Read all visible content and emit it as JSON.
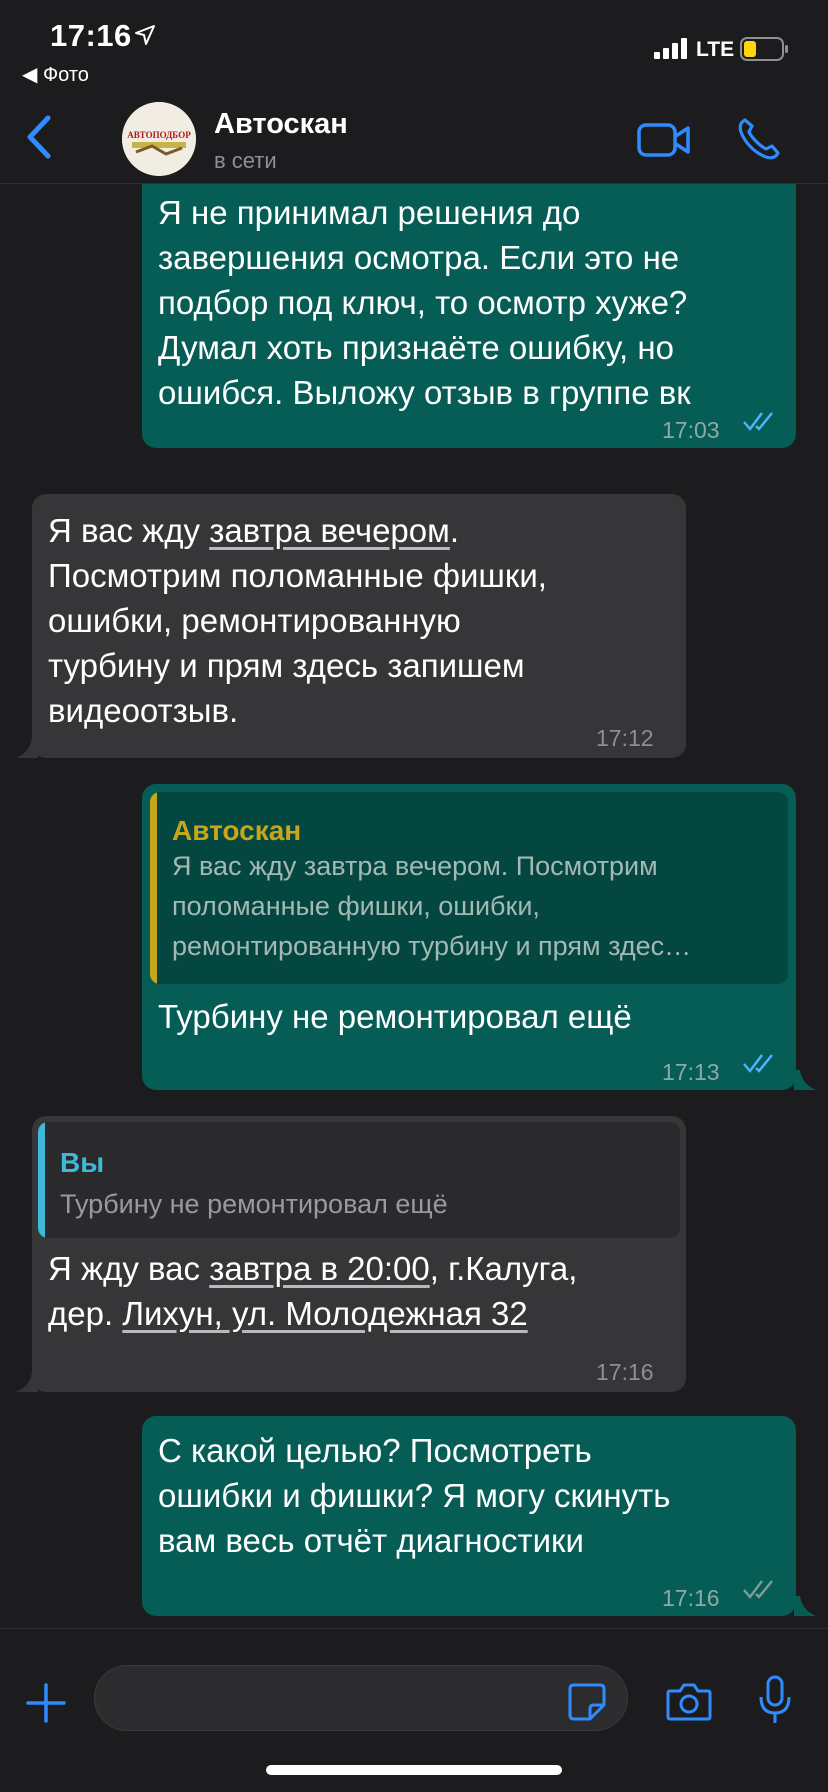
{
  "status_bar": {
    "time": "17:16",
    "back_app": "◀ Фото",
    "network": "LTE"
  },
  "header": {
    "contact_name": "Автоскан",
    "contact_status": "в сети",
    "avatar_text": "АВТОПОДБОР"
  },
  "messages": [
    {
      "direction": "outgoing",
      "lines": [
        "Я не принимал решения до",
        "завершения осмотра. Если это не",
        "подбор под ключ, то осмотр хуже?",
        "Думал хоть признаёте ошибку, но",
        "ошибся. Выложу отзыв в группе вк"
      ],
      "time": "17:03",
      "status": "read"
    },
    {
      "direction": "incoming",
      "line1_before": "Я вас жду ",
      "line1_link": "завтра вечером",
      "line1_after": ".",
      "lines_rest": [
        "Посмотрим поломанные фишки,",
        "ошибки, ремонтированную",
        "турбину и прям здесь запишем",
        "видеоотзыв."
      ],
      "time": "17:12"
    },
    {
      "direction": "outgoing",
      "quote_name": "Автоскан",
      "quote_lines": [
        "Я вас жду завтра вечером. Посмотрим",
        "поломанные фишки, ошибки,",
        "ремонтированную турбину и прям здес…"
      ],
      "text": "Турбину не ремонтировал ещё",
      "time": "17:13",
      "status": "read"
    },
    {
      "direction": "incoming",
      "quote_name": "Вы",
      "quote_text": "Турбину не ремонтировал ещё",
      "line1_before": "Я жду вас ",
      "line1_link": "завтра в 20:00",
      "line1_after": ", г.Калуга,",
      "line2_before": "дер. ",
      "line2_link": "Лихун, ул. Молодежная 32",
      "time": "17:16"
    },
    {
      "direction": "outgoing",
      "lines": [
        "С какой целью? Посмотреть",
        "ошибки и фишки? Я могу скинуть",
        "вам весь отчёт диагностики"
      ],
      "time": "17:16",
      "status": "delivered"
    }
  ],
  "colors": {
    "outgoing_bubble": "#055d56",
    "incoming_bubble": "#363638",
    "accent_blue": "#2f8cff",
    "quote_yellow": "#c8a61a",
    "quote_cyan": "#3fb9d9"
  }
}
